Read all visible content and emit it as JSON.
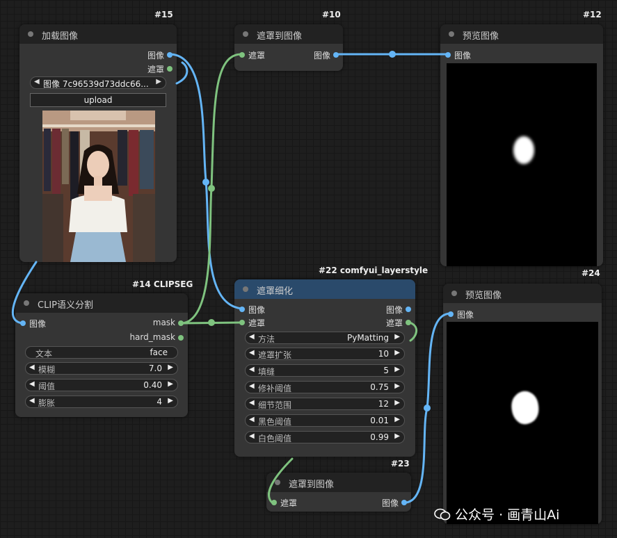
{
  "nodes": {
    "load_image": {
      "id": "#15",
      "title": "加载图像",
      "outputs": [
        "图像",
        "遮罩"
      ],
      "image_label": "图像",
      "image_value": "7c96539d73ddc66...",
      "upload_label": "upload"
    },
    "mask_to_image_top": {
      "id": "#10",
      "title": "遮罩到图像",
      "input": "遮罩",
      "output": "图像"
    },
    "preview_top": {
      "id": "#12",
      "title": "预览图像",
      "input": "图像"
    },
    "clipseg": {
      "id": "#14 CLIPSEG",
      "title": "CLIP语义分割",
      "input": "图像",
      "outputs": [
        "mask",
        "hard_mask"
      ],
      "widgets": [
        {
          "label": "文本",
          "value": "face"
        },
        {
          "label": "模糊",
          "value": "7.0"
        },
        {
          "label": "阈值",
          "value": "0.40"
        },
        {
          "label": "膨胀",
          "value": "4"
        }
      ]
    },
    "mask_refine": {
      "id": "#22 comfyui_layerstyle",
      "title": "遮罩细化",
      "inputs": [
        "图像",
        "遮罩"
      ],
      "outputs": [
        "图像",
        "遮罩"
      ],
      "widgets": [
        {
          "label": "方法",
          "value": "PyMatting"
        },
        {
          "label": "遮罩扩张",
          "value": "10"
        },
        {
          "label": "填缝",
          "value": "5"
        },
        {
          "label": "修补阈值",
          "value": "0.75"
        },
        {
          "label": "细节范围",
          "value": "12"
        },
        {
          "label": "黑色阈值",
          "value": "0.01"
        },
        {
          "label": "白色阈值",
          "value": "0.99"
        }
      ]
    },
    "preview_bottom": {
      "id": "#24",
      "title": "预览图像",
      "input": "图像"
    },
    "mask_to_image_bottom": {
      "id": "#23",
      "title": "遮罩到图像",
      "input": "遮罩",
      "output": "图像"
    }
  },
  "colors": {
    "image_wire": "#64b5f6",
    "mask_wire": "#7fc37f",
    "canvas": "#1e1e1e",
    "node": "#353535",
    "node_header_selected": "#2a4a6b"
  },
  "watermark": "公众号 · 画青山Ai"
}
